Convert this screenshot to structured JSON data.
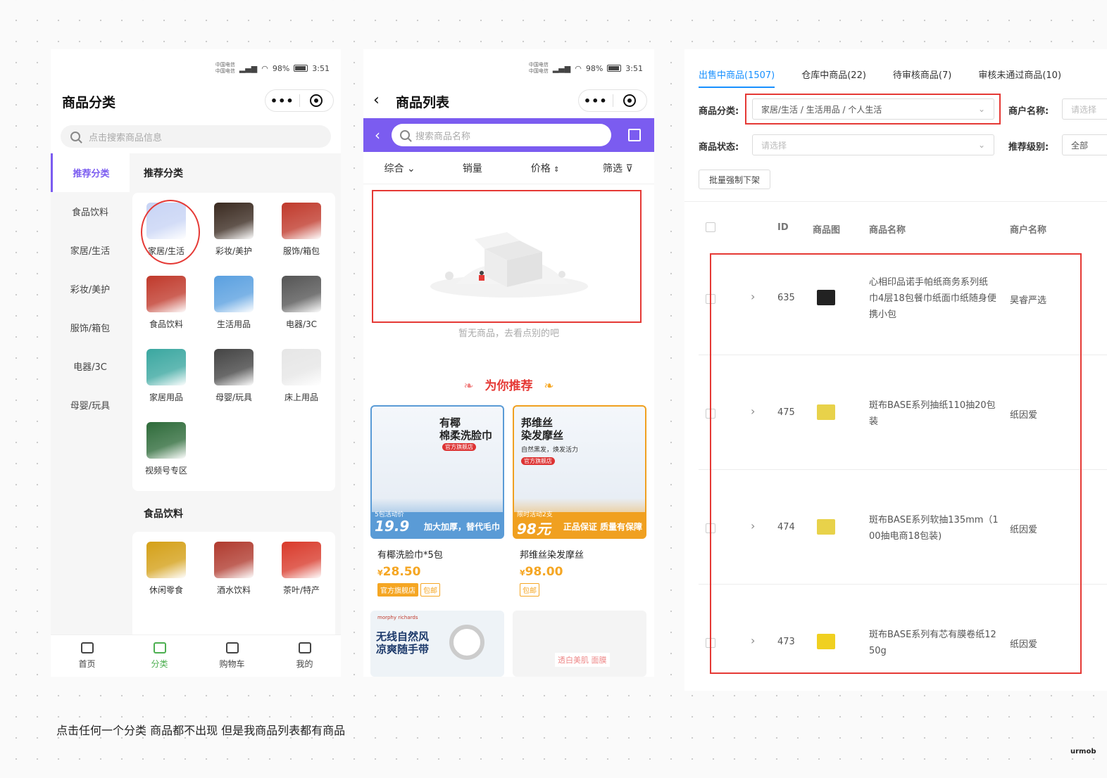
{
  "left_phone": {
    "carrier": [
      "中国电信",
      "中国电信"
    ],
    "status_text": "98%",
    "time": "3:51",
    "title": "商品分类",
    "search_placeholder": "点击搜索商品信息",
    "sidebar": [
      {
        "label": "推荐分类",
        "active": true
      },
      {
        "label": "食品饮料"
      },
      {
        "label": "家居/生活"
      },
      {
        "label": "彩妆/美护"
      },
      {
        "label": "服饰/箱包"
      },
      {
        "label": "电器/3C"
      },
      {
        "label": "母婴/玩具"
      }
    ],
    "section1_title": "推荐分类",
    "section1_items": [
      {
        "label": "家居/生活",
        "icon": "tissue-box-icon",
        "color": "#c8d4f5"
      },
      {
        "label": "彩妆/美护",
        "icon": "cosmetics-icon",
        "color": "#3a2a20"
      },
      {
        "label": "服饰/箱包",
        "icon": "luggage-icon",
        "color": "#c0392b"
      },
      {
        "label": "食品饮料",
        "icon": "gift-food-icon",
        "color": "#c0392b"
      },
      {
        "label": "生活用品",
        "icon": "detergent-icon",
        "color": "#5aa0e0"
      },
      {
        "label": "电器/3C",
        "icon": "appliance-icon",
        "color": "#555555"
      },
      {
        "label": "家居用品",
        "icon": "cleaning-supplies-icon",
        "color": "#3aa7a0"
      },
      {
        "label": "母婴/玩具",
        "icon": "toy-car-icon",
        "color": "#444444"
      },
      {
        "label": "床上用品",
        "icon": "image-placeholder-icon",
        "color": "#e6e6e6"
      },
      {
        "label": "视频号专区",
        "icon": "supplement-bottles-icon",
        "color": "#2e6b3a"
      }
    ],
    "section2_title": "食品饮料",
    "section2_items": [
      {
        "label": "休闲零食",
        "icon": "snacks-icon",
        "color": "#d4a017"
      },
      {
        "label": "酒水饮料",
        "icon": "liquor-icon",
        "color": "#b03a2e"
      },
      {
        "label": "茶叶/特产",
        "icon": "tea-icon",
        "color": "#d93a2b"
      }
    ],
    "tabbar": [
      {
        "label": "首页",
        "icon": "home-icon"
      },
      {
        "label": "分类",
        "icon": "category-icon",
        "active": true
      },
      {
        "label": "购物车",
        "icon": "cart-icon"
      },
      {
        "label": "我的",
        "icon": "user-icon"
      }
    ]
  },
  "middle_phone": {
    "carrier": [
      "中国电信",
      "中国电信"
    ],
    "status_text": "98%",
    "time": "3:51",
    "title": "商品列表",
    "search_placeholder": "搜索商品名称",
    "sort": [
      "综合",
      "销量",
      "价格",
      "筛选"
    ],
    "empty_text": "暂无商品，去看点别的吧",
    "recommend_title": "为你推荐",
    "products": [
      {
        "name": "有椰洗脸巾*5包",
        "currency": "¥",
        "price": "28.50",
        "tags": [
          "官方旗舰店",
          "包邮"
        ],
        "img_title": "有椰\n棉柔洗脸巾",
        "img_badge": "官方旗舰店",
        "img_price_label": "5包活动价",
        "img_price": "19.9",
        "img_slogan": "加大加厚，替代毛巾",
        "color": "#5a9bd6"
      },
      {
        "name": "邦维丝染发摩丝",
        "currency": "¥",
        "price": "98.00",
        "tags": [
          "包邮"
        ],
        "img_title": "邦维丝\n染发摩丝",
        "img_sub": "自然黑发，焕发活力",
        "img_badge": "官方旗舰店",
        "img_price_label": "限时活动2支",
        "img_price": "98元",
        "img_slogan": "正品保证 质量有保障",
        "color": "#f0a020"
      }
    ],
    "partial_cards": [
      {
        "brand": "morphy richards",
        "text": "无线自然风\n凉爽随手带"
      },
      {
        "text": "透白美肌 面膜"
      }
    ]
  },
  "admin": {
    "tabs": [
      {
        "label": "出售中商品(1507)",
        "active": true
      },
      {
        "label": "仓库中商品(22)"
      },
      {
        "label": "待审核商品(7)"
      },
      {
        "label": "审核未通过商品(10)"
      }
    ],
    "filters": {
      "category_label": "商品分类:",
      "category_value": "家居/生活 / 生活用品 / 个人生活",
      "merchant_label": "商户名称:",
      "merchant_placeholder": "请选择",
      "status_label": "商品状态:",
      "status_placeholder": "请选择",
      "level_label": "推荐级别:",
      "level_value": "全部"
    },
    "batch_button": "批量强制下架",
    "columns": [
      "ID",
      "商品图",
      "商品名称",
      "商户名称"
    ],
    "rows": [
      {
        "id": "635",
        "name": "心相印品诺手帕纸商务系列纸\n巾4层18包餐巾纸面巾纸随身便\n携小包",
        "merchant": "昊睿严选",
        "thumb_color": "#222222"
      },
      {
        "id": "475",
        "name": "斑布BASE系列抽纸110抽20包\n装",
        "merchant": "纸因爱",
        "thumb_color": "#e8d24a"
      },
      {
        "id": "474",
        "name": "斑布BASE系列软抽135mm（1\n00抽电商18包装)",
        "merchant": "纸因爱",
        "thumb_color": "#e8d24a"
      },
      {
        "id": "473",
        "name": "斑布BASE系列有芯有膜卷纸12\n50g",
        "merchant": "纸因爱",
        "thumb_color": "#f0d020"
      }
    ]
  },
  "caption": "点击任何一个分类  商品都不出现  但是我商品列表都有商品",
  "watermark": "urmob",
  "accent_colors": {
    "purple": "#7b5cf0",
    "red_annotation": "#e53935",
    "blue_link": "#1890ff",
    "price_orange": "#f5a623"
  }
}
